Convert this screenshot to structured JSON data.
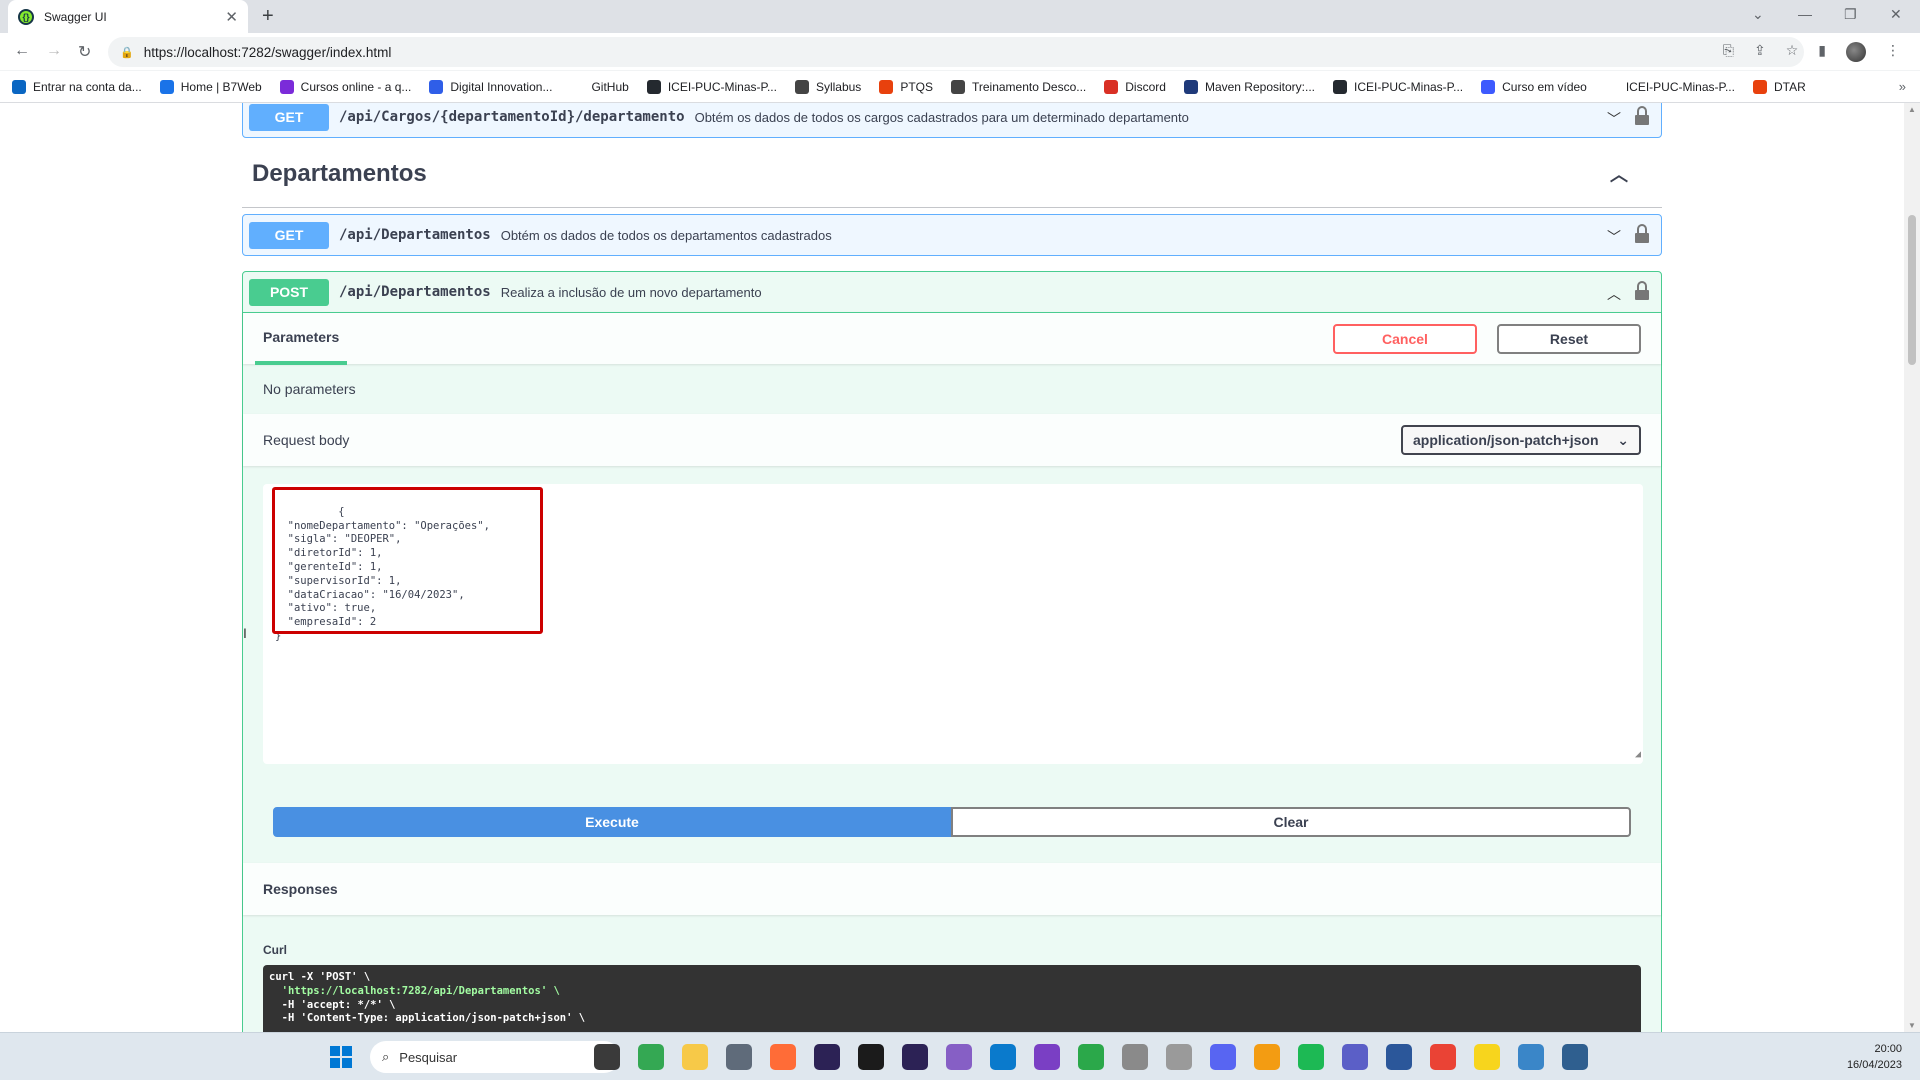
{
  "browser": {
    "tab_title": "Swagger UI",
    "url": "https://localhost:7282/swagger/index.html",
    "bookmarks": [
      {
        "label": "Entrar na conta da...",
        "color": "#0a66c2"
      },
      {
        "label": "Home | B7Web",
        "color": "#1a73e8"
      },
      {
        "label": "Cursos online - a q...",
        "color": "#7b2bd9"
      },
      {
        "label": "Digital Innovation...",
        "color": "#2f5ee8"
      },
      {
        "label": "GitHub",
        "color": "#ffffff"
      },
      {
        "label": "ICEI-PUC-Minas-P...",
        "color": "#24292f"
      },
      {
        "label": "Syllabus",
        "color": "#444444"
      },
      {
        "label": "PTQS",
        "color": "#e8410d"
      },
      {
        "label": "Treinamento Desco...",
        "color": "#444444"
      },
      {
        "label": "Discord",
        "color": "#d93025"
      },
      {
        "label": "Maven Repository:...",
        "color": "#1f3a7a"
      },
      {
        "label": "ICEI-PUC-Minas-P...",
        "color": "#24292f"
      },
      {
        "label": "Curso em vídeo",
        "color": "#3d5afe"
      },
      {
        "label": "ICEI-PUC-Minas-P...",
        "color": "#ffffff"
      },
      {
        "label": "DTAR",
        "color": "#e8410d"
      }
    ]
  },
  "swagger": {
    "cargos_op": {
      "method": "GET",
      "path": "/api/Cargos/{departamentoId}/departamento",
      "description": "Obtém os dados de todos os cargos cadastrados para um determinado departamento"
    },
    "section_title": "Departamentos",
    "get_op": {
      "method": "GET",
      "path": "/api/Departamentos",
      "description": "Obtém os dados de todos os departamentos cadastrados"
    },
    "post_op": {
      "method": "POST",
      "path": "/api/Departamentos",
      "description": "Realiza a inclusão de um novo departamento"
    },
    "parameters_tab": "Parameters",
    "cancel_label": "Cancel",
    "reset_label": "Reset",
    "no_params": "No parameters",
    "request_body_label": "Request body",
    "content_type": "application/json-patch+json",
    "request_body_text": "{\n  \"nomeDepartamento\": \"Operações\",\n  \"sigla\": \"DEOPER\",\n  \"diretorId\": 1,\n  \"gerenteId\": 1,\n  \"supervisorId\": 1,\n  \"dataCriacao\": \"16/04/2023\",\n  \"ativo\": true,\n  \"empresaId\": 2\n}",
    "execute_label": "Execute",
    "clear_label": "Clear",
    "responses_label": "Responses",
    "curl_label": "Curl",
    "curl_lines": [
      "curl -X 'POST' \\",
      "  'https://localhost:7282/api/Departamentos' \\",
      "  -H 'accept: */*' \\",
      "  -H 'Content-Type: application/json-patch+json' \\"
    ]
  },
  "taskbar": {
    "search_placeholder": "Pesquisar",
    "time": "20:00",
    "date": "16/04/2023",
    "apps": [
      {
        "name": "explorer",
        "color": "#3a3a3a"
      },
      {
        "name": "chrome",
        "color": "#34a853"
      },
      {
        "name": "files",
        "color": "#f7c948"
      },
      {
        "name": "settings",
        "color": "#5f6b7a"
      },
      {
        "name": "postman",
        "color": "#ff6c37"
      },
      {
        "name": "eclipse-dark",
        "color": "#2c2255"
      },
      {
        "name": "intellij",
        "color": "#1b1b1b"
      },
      {
        "name": "eclipse",
        "color": "#2c2255"
      },
      {
        "name": "visual-studio",
        "color": "#865fc5"
      },
      {
        "name": "vscode",
        "color": "#0a7acc"
      },
      {
        "name": "github-desktop",
        "color": "#7a3fc4"
      },
      {
        "name": "tool",
        "color": "#2ba84a"
      },
      {
        "name": "db",
        "color": "#8a8a8a"
      },
      {
        "name": "db2",
        "color": "#9a9a9a"
      },
      {
        "name": "discord",
        "color": "#5865f2"
      },
      {
        "name": "box",
        "color": "#f39c12"
      },
      {
        "name": "spotify",
        "color": "#1db954"
      },
      {
        "name": "teams",
        "color": "#5b5fc7"
      },
      {
        "name": "word",
        "color": "#2b579a"
      },
      {
        "name": "chrome2",
        "color": "#ea4335"
      },
      {
        "name": "sticky",
        "color": "#f7d51d"
      },
      {
        "name": "notepad",
        "color": "#3a86c8"
      },
      {
        "name": "terminal",
        "color": "#2f5f8f"
      }
    ]
  }
}
